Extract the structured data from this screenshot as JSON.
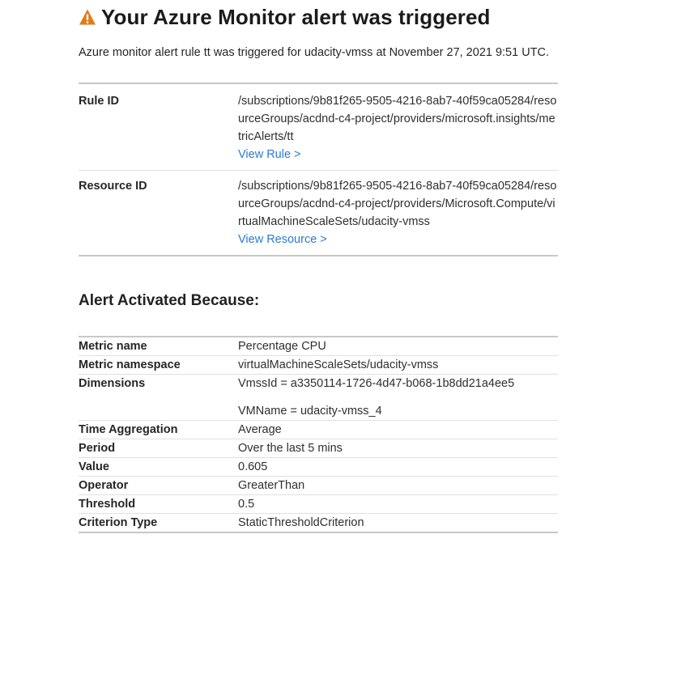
{
  "header": {
    "title": "Your Azure Monitor alert was triggered",
    "icon": "warning-triangle-icon",
    "icon_color": "#e07b1b"
  },
  "intro_text": "Azure monitor alert rule tt was triggered for udacity-vmss at November 27, 2021 9:51 UTC.",
  "rule": {
    "rule_id_label": "Rule ID",
    "rule_id_value": "/subscriptions/9b81f265-9505-4216-8ab7-40f59ca05284/resourceGroups/acdnd-c4-project/providers/microsoft.insights/metricAlerts/tt",
    "view_rule_link": "View Rule >",
    "resource_id_label": "Resource ID",
    "resource_id_value": "/subscriptions/9b81f265-9505-4216-8ab7-40f59ca05284/resourceGroups/acdnd-c4-project/providers/Microsoft.Compute/virtualMachineScaleSets/udacity-vmss",
    "view_resource_link": "View Resource >"
  },
  "section_title": "Alert Activated Because:",
  "metrics": {
    "metric_name_label": "Metric name",
    "metric_name_value": "Percentage CPU",
    "metric_namespace_label": "Metric namespace",
    "metric_namespace_value": "virtualMachineScaleSets/udacity-vmss",
    "dimensions_label": "Dimensions",
    "dimension_1": "VmssId = a3350114-1726-4d47-b068-1b8dd21a4ee5",
    "dimension_2": "VMName = udacity-vmss_4",
    "time_aggregation_label": "Time Aggregation",
    "time_aggregation_value": "Average",
    "period_label": "Period",
    "period_value": "Over the last 5 mins",
    "value_label": "Value",
    "value_value": "0.605",
    "operator_label": "Operator",
    "operator_value": "GreaterThan",
    "threshold_label": "Threshold",
    "threshold_value": "0.5",
    "criterion_type_label": "Criterion Type",
    "criterion_type_value": "StaticThresholdCriterion"
  },
  "colors": {
    "link": "#2a7bd0",
    "warning": "#e07b1b",
    "divider": "#c8c8c8"
  }
}
